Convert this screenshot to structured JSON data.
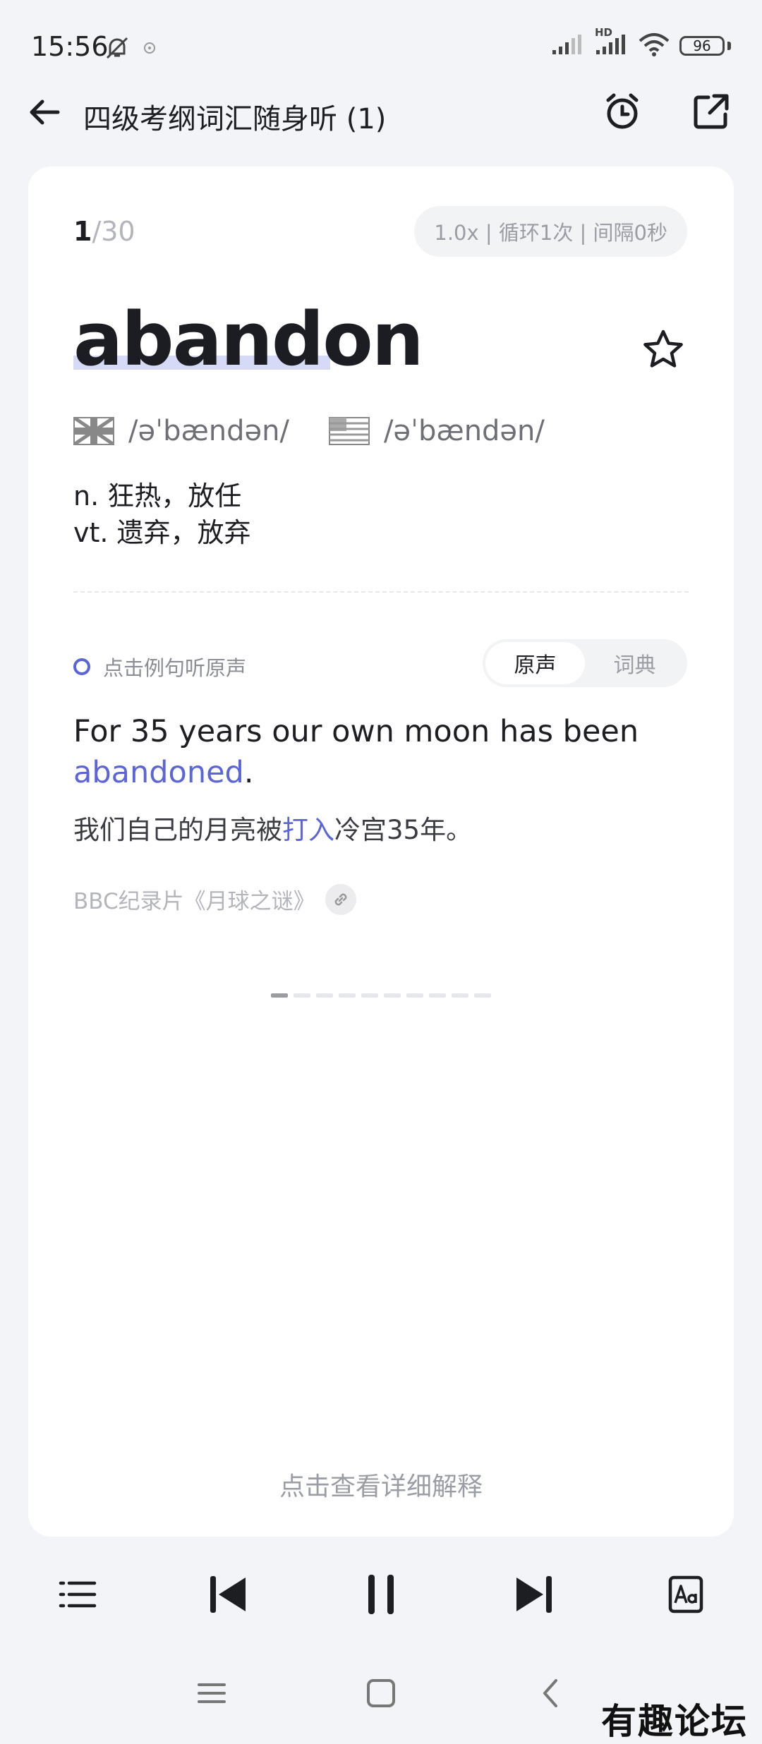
{
  "status": {
    "time": "15:56",
    "battery": "96",
    "network": "HD"
  },
  "header": {
    "title": "四级考纲词汇随身听 (1)",
    "icons": [
      "back-arrow-icon",
      "alarm-clock-icon",
      "share-icon"
    ]
  },
  "card": {
    "progress_current": "1",
    "progress_total": "/30",
    "settings": "1.0x | 循环1次 | 间隔0秒",
    "word": "abandon",
    "uk_phonetic": "/əˈbændən/",
    "us_phonetic": "/əˈbændən/",
    "definitions": [
      "n. 狂热，放任",
      "vt. 遗弃，放弃"
    ],
    "hint": "点击例句听原声",
    "toggle": {
      "original": "原声",
      "dictionary": "词典",
      "selected": "原声"
    },
    "sentence_en_prefix": "For 35 years our own moon has been ",
    "sentence_en_highlight": "abandoned",
    "sentence_en_suffix": ".",
    "sentence_zh_prefix": "我们自己的月亮被",
    "sentence_zh_highlight": "打入",
    "sentence_zh_suffix": "冷宫35年。",
    "source": "BBC纪录片《月球之谜》",
    "page_dots": {
      "total": 10,
      "active": 0
    },
    "more": "点击查看详细解释"
  },
  "player": {
    "icons": [
      "list-icon",
      "previous-icon",
      "pause-icon",
      "next-icon",
      "font-size-icon"
    ]
  },
  "colors": {
    "accent": "#5b65d8",
    "background": "#f3f4f7",
    "card": "#ffffff"
  },
  "watermark": "有趣论坛"
}
